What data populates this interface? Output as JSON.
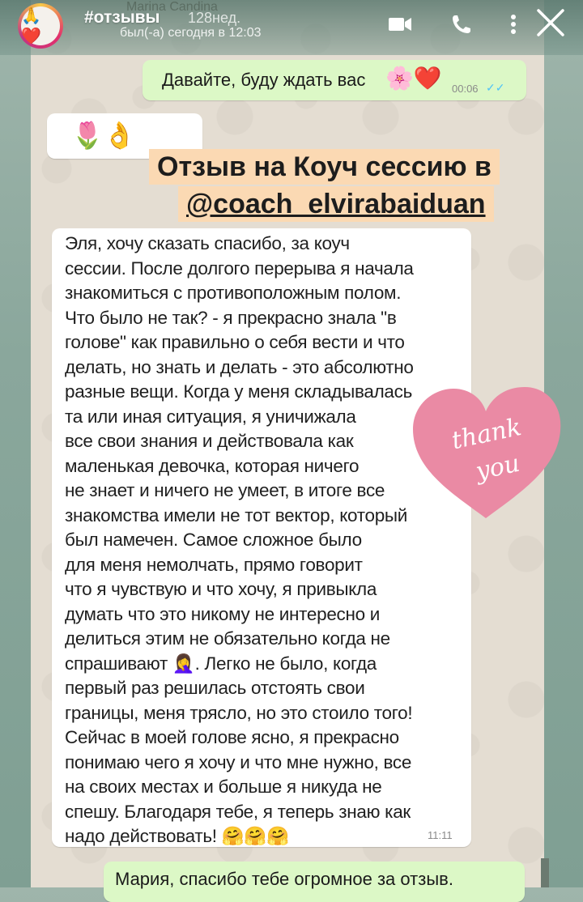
{
  "story": {
    "title": "#отзывы",
    "age": "128нед."
  },
  "chat_header": {
    "contact_name": "Marina Candina",
    "status": "был(-а) сегодня в 12:03"
  },
  "icons": {
    "video": "video-call-icon",
    "phone": "phone-call-icon",
    "menu": "more-options-icon",
    "close": "close-icon"
  },
  "messages": [
    {
      "type": "out",
      "text": "Давайте, буду ждать вас",
      "emoji": "🌸❤️",
      "time": "00:06"
    },
    {
      "type": "in",
      "emoji": "🌷👌"
    },
    {
      "type": "in",
      "lines": [
        "Эля, хочу сказать спасибо, за коуч",
        "сессии. После долгого перерыва я начала",
        "знакомиться с противоположным полом.",
        "Что было не так? - я прекрасно знала \"в",
        "голове\" как правильно о себя вести и что",
        "делать, но знать и делать - это абсолютно",
        "разные вещи. Когда у меня складывалась",
        "та или иная ситуация, я уничижала",
        "все свои знания и действовала как",
        "маленькая девочка, которая ничего",
        "не знает и ничего не умеет, в итоге все",
        "знакомства имели не тот вектор, который",
        "был намечен. Самое сложное было",
        "для меня немолчать, прямо говорит",
        "что я чувствую и что хочу, я привыкла",
        "думать что это никому не интересно и",
        "делиться этим не обязательно когда не",
        "спрашивают 🤦‍♀️. Легко не было, когда",
        "первый раз решилась отстоять свои",
        "границы, меня трясло, но это стоило того!",
        "Сейчас в моей голове ясно, я прекрасно",
        "понимаю чего я хочу и что мне нужно, все",
        "на своих местах и больше я никуда не",
        "спешу. Благодаря тебе, я теперь знаю как",
        "надо действовать! 🤗🤗🤗"
      ],
      "time": "11:11"
    },
    {
      "type": "out",
      "text": "Мария,  спасибо тебе огромное за отзыв."
    }
  ],
  "overlay": {
    "line1": "Отзыв на Коуч сессию в",
    "line2": "@coach_elvirabaiduan"
  },
  "sticker": {
    "line1": "thank",
    "line2": "you"
  },
  "colors": {
    "out_bubble": "#dcf8c6",
    "in_bubble": "#ffffff",
    "highlight": "#fbd9b3",
    "heart": "#ea8aa4"
  }
}
